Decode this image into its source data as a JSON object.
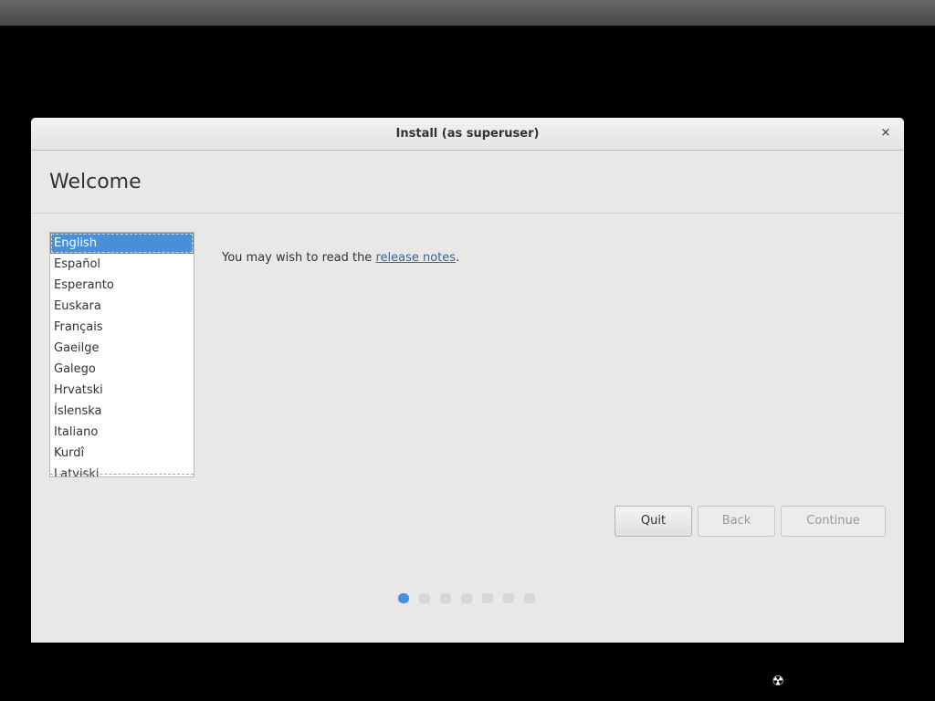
{
  "window": {
    "title": "Install (as superuser)",
    "close_label": "×"
  },
  "header": {
    "heading": "Welcome"
  },
  "languages": [
    {
      "label": "English",
      "selected": true
    },
    {
      "label": "Español"
    },
    {
      "label": "Esperanto"
    },
    {
      "label": "Euskara"
    },
    {
      "label": "Français"
    },
    {
      "label": "Gaeilge"
    },
    {
      "label": "Galego"
    },
    {
      "label": "Hrvatski"
    },
    {
      "label": "Íslenska"
    },
    {
      "label": "Italiano"
    },
    {
      "label": "Kurdî"
    },
    {
      "label": "Latviski"
    }
  ],
  "notes": {
    "prefix": "You may wish to read the ",
    "link": "release notes",
    "suffix": "."
  },
  "buttons": {
    "quit": "Quit",
    "back": "Back",
    "continue": "Continue"
  },
  "progress": {
    "current_step": 1,
    "total_steps": 7
  },
  "tray": {
    "icon": "network-icon",
    "glyph": "☢"
  },
  "colors": {
    "accent": "#4a90d9",
    "link": "#3465a4"
  }
}
